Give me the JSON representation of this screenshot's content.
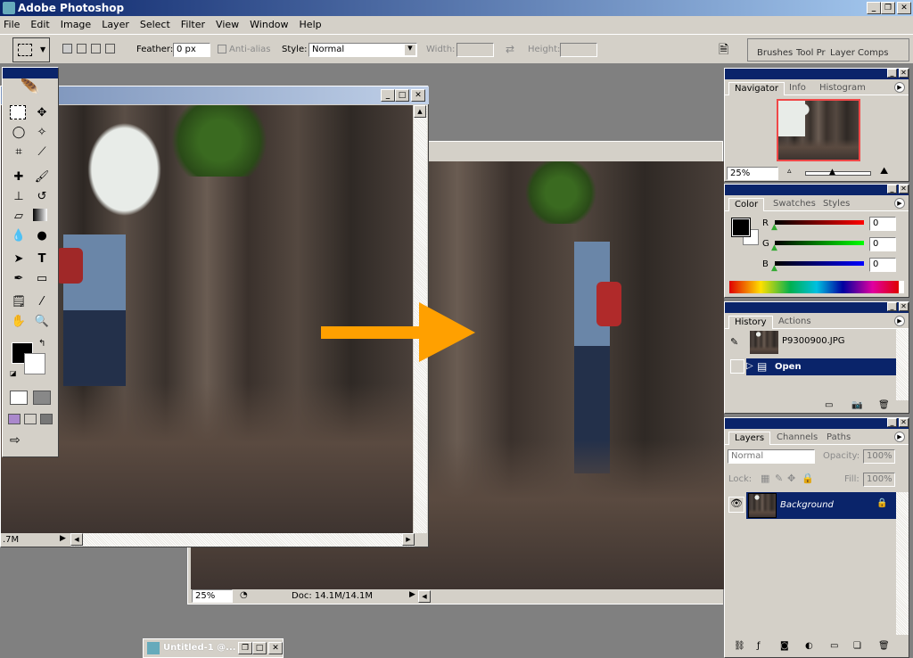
{
  "app": {
    "title": "Adobe Photoshop"
  },
  "menu": [
    "File",
    "Edit",
    "Image",
    "Layer",
    "Select",
    "Filter",
    "View",
    "Window",
    "Help"
  ],
  "options": {
    "feather_label": "Feather:",
    "feather_value": "0 px",
    "antialias_label": "Anti-alias",
    "style_label": "Style:",
    "style_value": "Normal",
    "width_label": "Width:",
    "height_label": "Height:"
  },
  "palette_well": {
    "tabs": [
      "Brushes",
      "Tool Pr",
      "Layer Comps"
    ]
  },
  "doc1": {
    "status": ".7M"
  },
  "doc2": {
    "zoom": "25%",
    "status": "Doc: 14.1M/14.1M"
  },
  "minimized": {
    "title": "Untitled-1 @..."
  },
  "navigator": {
    "tabs": [
      "Navigator",
      "Info",
      "Histogram"
    ],
    "zoom": "25%"
  },
  "color": {
    "tabs": [
      "Color",
      "Swatches",
      "Styles"
    ],
    "channels": [
      {
        "label": "R",
        "value": "0",
        "color": "#ff0000"
      },
      {
        "label": "G",
        "value": "0",
        "color": "#00ff00"
      },
      {
        "label": "B",
        "value": "0",
        "color": "#0000ff"
      }
    ],
    "foreground": "#000000",
    "background": "#ffffff"
  },
  "history": {
    "tabs": [
      "History",
      "Actions"
    ],
    "snapshot": "P9300900.JPG",
    "items": [
      {
        "label": "Open",
        "selected": true
      }
    ]
  },
  "layers": {
    "tabs": [
      "Layers",
      "Channels",
      "Paths"
    ],
    "blend": "Normal",
    "opacity_label": "Opacity:",
    "opacity": "100%",
    "lock_label": "Lock:",
    "fill_label": "Fill:",
    "fill": "100%",
    "items": [
      {
        "name": "Background",
        "locked": true,
        "visible": true
      }
    ]
  },
  "arrow_color": "#ffa000"
}
